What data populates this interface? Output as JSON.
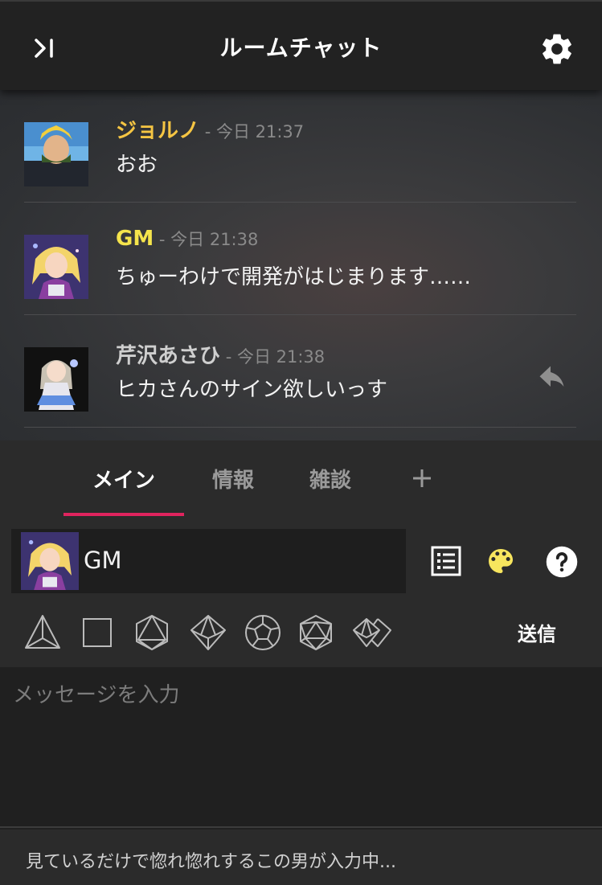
{
  "header": {
    "title": "ルームチャット",
    "close_icon": "collapse-right-icon",
    "settings_icon": "gear-icon"
  },
  "messages": [
    {
      "name": "ジョルノ",
      "time": "- 今日 21:37",
      "text": "おお",
      "name_color": "#f5c543"
    },
    {
      "name": "GM",
      "time": "- 今日 21:38",
      "text": "ちゅーわけで開発がはじまります……",
      "name_color": "#f5e44c"
    },
    {
      "name": "芹沢あさひ",
      "time": "- 今日 21:38",
      "text": "ヒカさんのサイン欲しいっす",
      "name_color": "#cfcfcf"
    }
  ],
  "tabs": [
    {
      "label": "メイン",
      "active": true
    },
    {
      "label": "情報",
      "active": false
    },
    {
      "label": "雑談",
      "active": false
    }
  ],
  "compose": {
    "character_name": "GM",
    "send_label": "送信",
    "dice": [
      "d4",
      "d6",
      "d8",
      "d10",
      "d12",
      "d20",
      "d100"
    ],
    "placeholder": "メッセージを入力"
  },
  "status": {
    "typing_text": "見ているだけで惚れ惚れするこの男が入力中..."
  },
  "colors": {
    "accent": "#e0245e",
    "palette": "#f7e55e",
    "background": "#212121"
  }
}
